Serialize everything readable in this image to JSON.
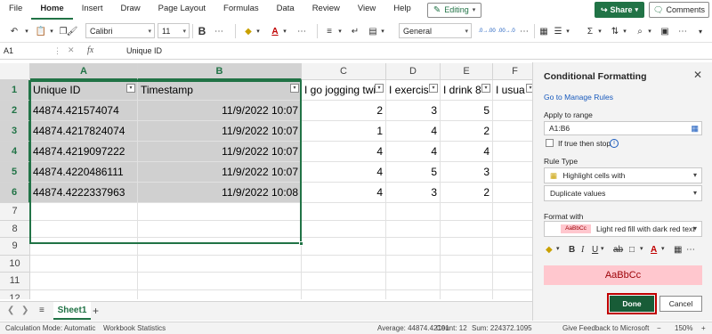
{
  "ribbon": {
    "tabs": [
      "File",
      "Home",
      "Insert",
      "Draw",
      "Page Layout",
      "Formulas",
      "Data",
      "Review",
      "View",
      "Help"
    ],
    "active_tab": "Home",
    "editing_label": "Editing",
    "share_label": "Share",
    "comments_label": "Comments",
    "font_name": "Calibri",
    "font_size": "11",
    "number_format": "General",
    "bold_label": "B",
    "font_color_label": "A",
    "decimal_increase_label": ".0→.00",
    "decimal_decrease_label": ".00→.0"
  },
  "formula_bar": {
    "name_box": "A1",
    "fx_label": "fx",
    "content": "Unique ID"
  },
  "grid": {
    "columns": [
      {
        "label": "A",
        "selected": true
      },
      {
        "label": "B",
        "selected": true
      },
      {
        "label": "C",
        "selected": false
      },
      {
        "label": "D",
        "selected": false
      },
      {
        "label": "E",
        "selected": false
      },
      {
        "label": "F",
        "selected": false
      }
    ],
    "row_numbers": [
      "1",
      "2",
      "3",
      "4",
      "5",
      "6",
      "7",
      "8",
      "9",
      "10",
      "11",
      "12"
    ],
    "selected_rows": 6,
    "header_row": [
      "Unique ID",
      "Timestamp",
      "I go jogging twi",
      "I exercis",
      "I drink 8",
      "I usua"
    ],
    "data_rows": [
      [
        "44874.421574074",
        "11/9/2022 10:07",
        "2",
        "3",
        "5",
        ""
      ],
      [
        "44874.4217824074",
        "11/9/2022 10:07",
        "1",
        "4",
        "2",
        ""
      ],
      [
        "44874.4219097222",
        "11/9/2022 10:07",
        "4",
        "4",
        "4",
        ""
      ],
      [
        "44874.4220486111",
        "11/9/2022 10:07",
        "4",
        "5",
        "3",
        ""
      ],
      [
        "44874.4222337963",
        "11/9/2022 10:08",
        "4",
        "3",
        "2",
        ""
      ]
    ]
  },
  "sheets": {
    "tabs": [
      "Sheet1"
    ],
    "add_label": "+"
  },
  "status_bar": {
    "calc_mode": "Calculation Mode: Automatic",
    "workbook_stats": "Workbook Statistics",
    "average": "Average: 44874.42191",
    "count": "Count: 12",
    "sum": "Sum: 224372.1095",
    "feedback": "Give Feedback to Microsoft",
    "zoom": "150%"
  },
  "pane": {
    "title": "Conditional Formatting",
    "manage_link": "Go to Manage Rules",
    "apply_label": "Apply to range",
    "range_value": "A1:B6",
    "stop_label": "If true then stop",
    "rule_type_label": "Rule Type",
    "rule_type_value": "Highlight cells with",
    "rule_condition_value": "Duplicate values",
    "format_label": "Format with",
    "format_swatch": "AaBbCc",
    "format_value": "Light red fill with dark red text",
    "preview_text": "AaBbCc",
    "done_label": "Done",
    "cancel_label": "Cancel"
  },
  "colors": {
    "accent": "#217346",
    "done_bg": "#185c37",
    "highlight_fill": "#ffc7ce",
    "highlight_text": "#9c0006",
    "selection_fill": "#d0d0d0"
  }
}
